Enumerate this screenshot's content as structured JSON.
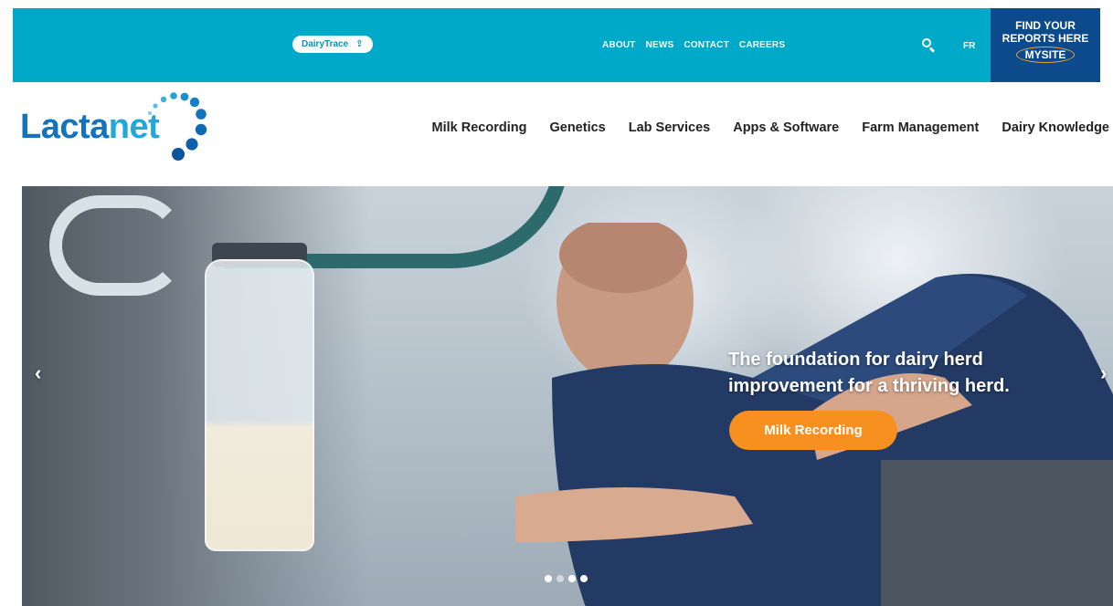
{
  "topbar": {
    "dairytrace_label": "DairyTrace",
    "upload_glyph": "⇪",
    "links": [
      "ABOUT",
      "NEWS",
      "CONTACT",
      "CAREERS"
    ],
    "lang": "FR",
    "reports_line1": "FIND YOUR",
    "reports_line2": "REPORTS HERE",
    "reports_line3": "MYSITE"
  },
  "logo": {
    "part1": "Lacta",
    "part2": "net"
  },
  "mainnav": [
    "Milk Recording",
    "Genetics",
    "Lab Services",
    "Apps & Software",
    "Farm Management",
    "Dairy Knowledge"
  ],
  "hero": {
    "caption_line1": "The foundation for dairy herd",
    "caption_line2": "improvement for a thriving herd.",
    "cta_label": "Milk Recording",
    "prev_glyph": "‹",
    "next_glyph": "›",
    "slide_count": 4,
    "active_slide": 1
  },
  "colors": {
    "topbar": "#00a9c7",
    "reports": "#0c4a8c",
    "cta": "#f7901e",
    "logo_dark": "#1572bd",
    "logo_light": "#1fa8dc"
  },
  "icons": {
    "search": "search-icon",
    "upload": "upload-icon",
    "prev": "chevron-left-icon",
    "next": "chevron-right-icon"
  }
}
